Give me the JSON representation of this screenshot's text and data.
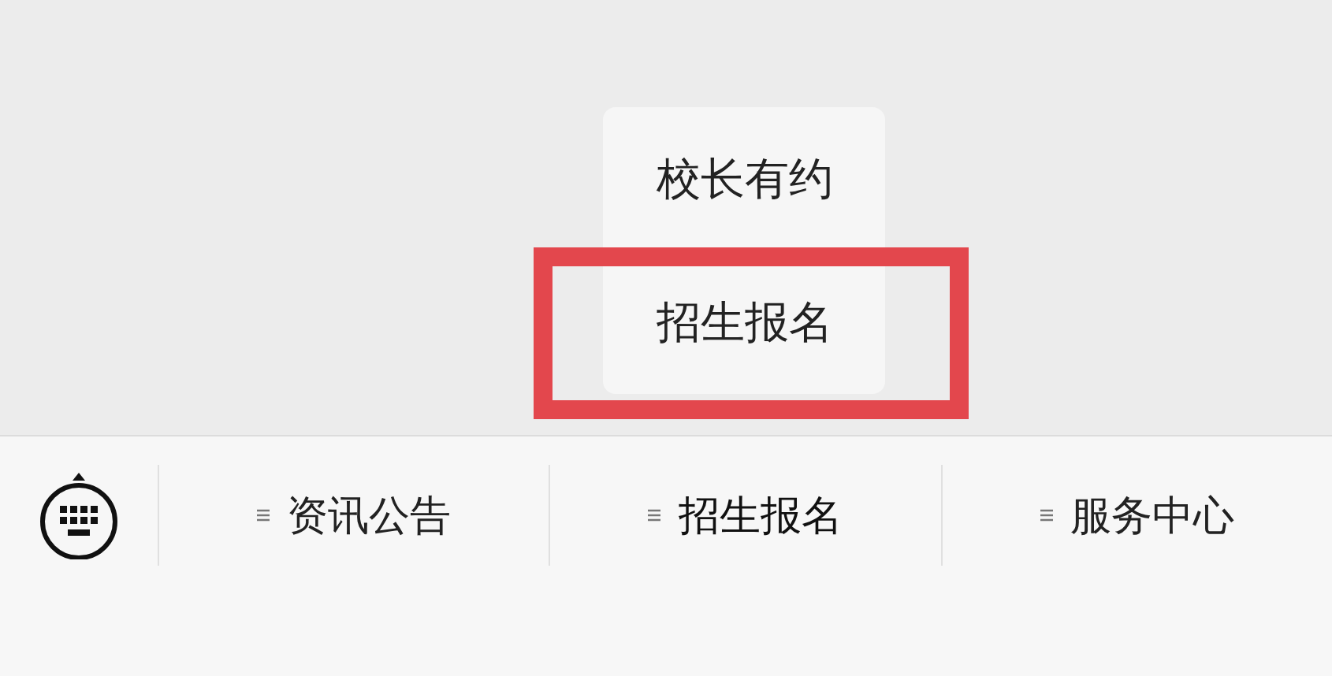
{
  "menu_bar": {
    "items": [
      {
        "label": "资讯公告",
        "has_submenu": true,
        "expanded": false
      },
      {
        "label": "招生报名",
        "has_submenu": true,
        "expanded": true,
        "submenu": [
          {
            "label": "校长有约",
            "highlighted": false
          },
          {
            "label": "招生报名",
            "highlighted": true
          }
        ]
      },
      {
        "label": "服务中心",
        "has_submenu": true,
        "expanded": false
      }
    ]
  }
}
